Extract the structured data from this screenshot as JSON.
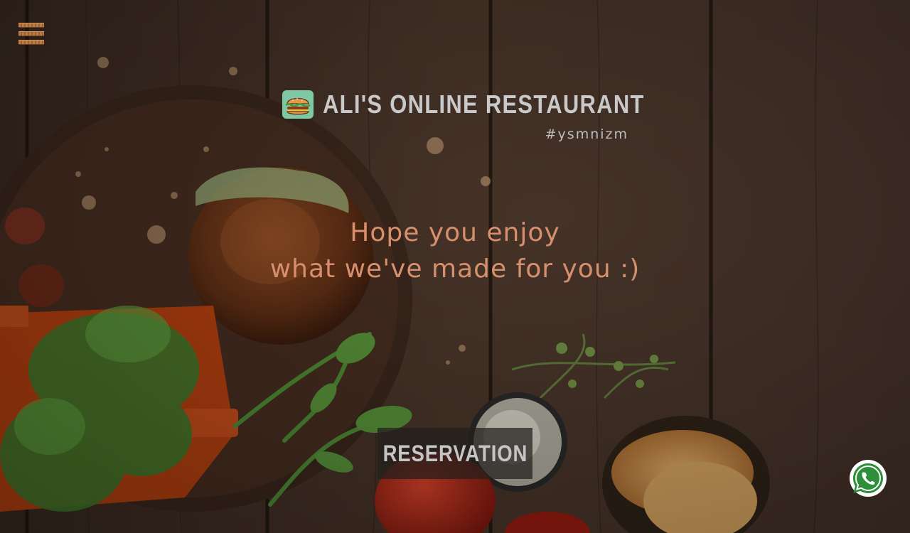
{
  "nav": {
    "menu_icon": "hamburger-menu-icon"
  },
  "brand": {
    "logo_icon": "burger-icon",
    "title": "ALI'S ONLINE RESTAURANT",
    "hashtag": "#ysmnizm"
  },
  "hero": {
    "tagline_line1": "Hope you enjoy",
    "tagline_line2": "what we've made for you :)",
    "tagline_color": "#d88f6e"
  },
  "cta": {
    "reservation_label": "RESERVATION"
  },
  "whatsapp": {
    "icon": "whatsapp-icon",
    "color": "#2e8f3b"
  },
  "colors": {
    "wood_dark": "#2b1d16",
    "wood_mid": "#4a3326",
    "accent_copper": "#b77a45",
    "title_grey": "#c9c9c9"
  }
}
